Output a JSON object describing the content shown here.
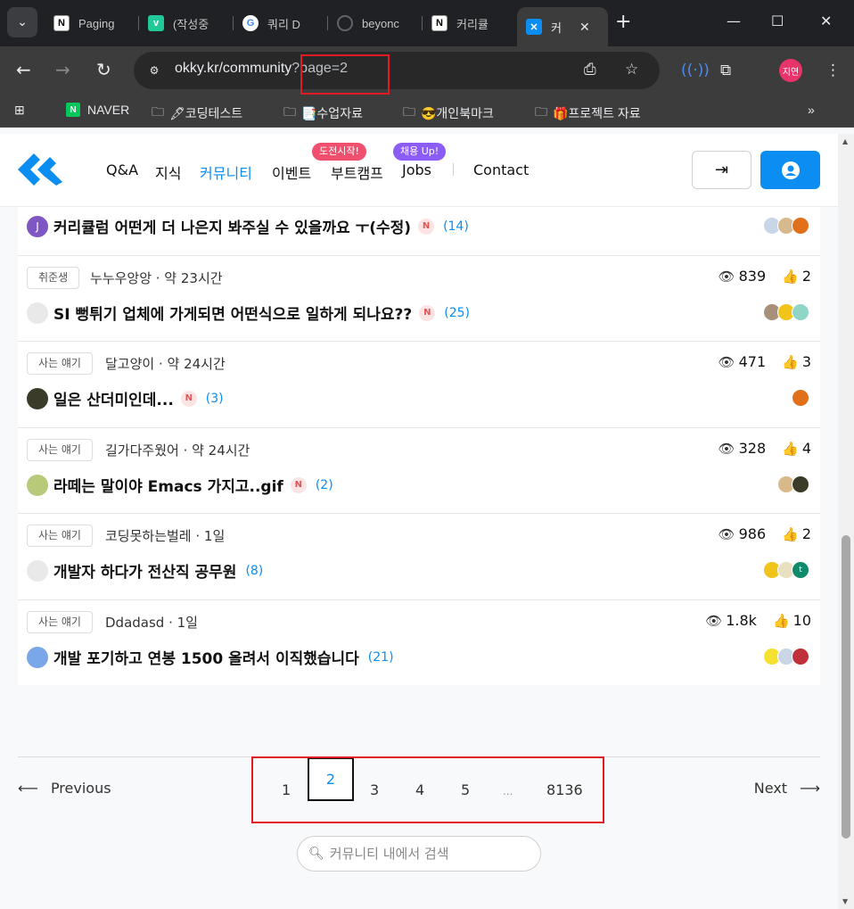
{
  "browser": {
    "tabs": [
      {
        "title": "Paging",
        "favicon": "N",
        "fav_bg": "#ffffff",
        "fav_fg": "#000000"
      },
      {
        "title": "(작성중",
        "favicon": "v",
        "fav_bg": "#20c997",
        "fav_fg": "#ffffff"
      },
      {
        "title": "쿼리 D",
        "favicon": "G",
        "fav_bg": "#ffffff",
        "fav_fg": "#4285f4"
      },
      {
        "title": "beyonc",
        "favicon": "github-icon",
        "fav_bg": "#202124",
        "fav_fg": "#c4c7c5"
      },
      {
        "title": "커리큘",
        "favicon": "N",
        "fav_bg": "#ffffff",
        "fav_fg": "#000000"
      },
      {
        "title": "커",
        "favicon": "okky-icon",
        "fav_bg": "#0b8df2",
        "fav_fg": "#ffffff"
      }
    ],
    "url_host": "okky.kr/community",
    "url_query": "?page=2",
    "profile_initials": "지연",
    "bookmarks": [
      {
        "label": "NAVER",
        "icon": "naver-icon"
      },
      {
        "label": "🖋코딩테스트",
        "icon": "folder-icon"
      },
      {
        "label": "📑수업자료",
        "icon": "folder-icon"
      },
      {
        "label": "😎개인북마크",
        "icon": "folder-icon"
      },
      {
        "label": "🎁프로젝트 자료",
        "icon": "folder-icon"
      }
    ]
  },
  "site": {
    "nav": [
      "Q&A",
      "지식",
      "커뮤니티",
      "이벤트",
      "부트캠프",
      "Jobs",
      "Contact"
    ],
    "badges": {
      "bootcamp": "도전시작!",
      "jobs": "채용 Up!"
    },
    "colors": {
      "accent": "#0b8df2",
      "badge_red": "#f0506e",
      "badge_purple": "#8b5cf6"
    }
  },
  "posts": [
    {
      "title": "커리큘럼 어떤게 더 나은지 봐주실 수 있을까요 ㅜ(수정)",
      "new": "N",
      "comments": "(14)",
      "avatar": "J"
    },
    {
      "category": "취준생",
      "author": "누누우앙앙 · 약 23시간",
      "views": "839",
      "likes": "2",
      "title": "SI 뻥튀기 업체에 가게되면 어떤식으로 일하게 되나요??",
      "new": "N",
      "comments": "(25)"
    },
    {
      "category": "사는 얘기",
      "author": "달고양이 · 약 24시간",
      "views": "471",
      "likes": "3",
      "title": "일은 산더미인데...",
      "new": "N",
      "comments": "(3)"
    },
    {
      "category": "사는 얘기",
      "author": "길가다주웠어 · 약 24시간",
      "views": "328",
      "likes": "4",
      "title": "라떼는 말이야 Emacs 가지고..gif",
      "new": "N",
      "comments": "(2)"
    },
    {
      "category": "사는 얘기",
      "author": "코딩못하는벌레 · 1일",
      "views": "986",
      "likes": "2",
      "title": "개발자 하다가 전산직 공무원",
      "comments": "(8)"
    },
    {
      "category": "사는 얘기",
      "author": "Ddadasd · 1일",
      "views": "1.8k",
      "likes": "10",
      "title": "개발 포기하고 연봉 1500 올려서 이직했습니다",
      "comments": "(21)"
    }
  ],
  "pagination": {
    "prev": "Previous",
    "next": "Next",
    "pages": [
      "1",
      "2",
      "3",
      "4",
      "5",
      "...",
      "8136"
    ],
    "current": "2"
  },
  "search": {
    "placeholder": "커뮤니티 내에서 검색"
  }
}
